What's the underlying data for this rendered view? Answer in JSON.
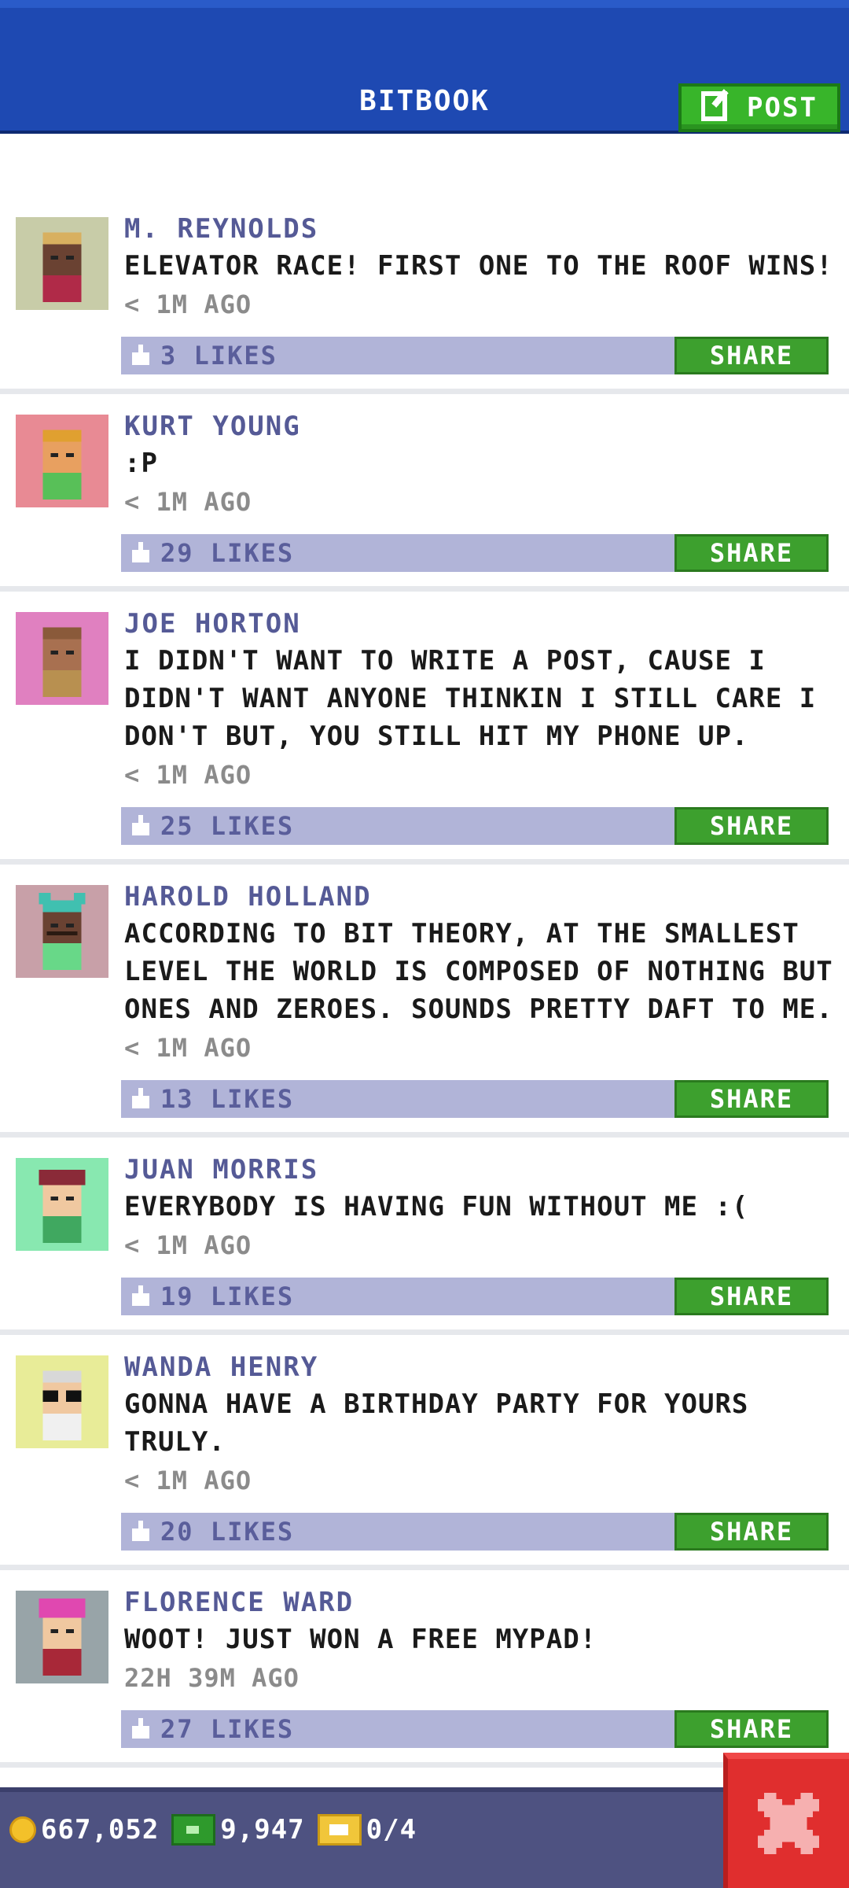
{
  "header": {
    "title": "BITBOOK",
    "post_button_label": "POST"
  },
  "colors": {
    "header_bg": "#1e49b2",
    "post_button_bg": "#38b52a",
    "likes_bar_bg": "#b1b4d8",
    "share_button_bg": "#3da02e",
    "author_color": "#555a96",
    "footer_bg": "#4e5281",
    "close_button_bg": "#e02e2e"
  },
  "posts": [
    {
      "author": "M. REYNOLDS",
      "message": "ELEVATOR RACE! FIRST ONE TO THE ROOF WINS!",
      "time": "< 1M AGO",
      "likes": "3 LIKES",
      "share_label": "SHARE"
    },
    {
      "author": "KURT YOUNG",
      "message": ":P",
      "time": "< 1M AGO",
      "likes": "29 LIKES",
      "share_label": "SHARE"
    },
    {
      "author": "JOE HORTON",
      "message": "I DIDN'T WANT TO WRITE A POST, CAUSE I DIDN'T WANT ANYONE THINKIN I STILL CARE I DON'T BUT, YOU STILL HIT MY PHONE UP.",
      "time": "< 1M AGO",
      "likes": "25 LIKES",
      "share_label": "SHARE"
    },
    {
      "author": "HAROLD HOLLAND",
      "message": "ACCORDING TO BIT THEORY, AT THE SMALLEST LEVEL THE WORLD IS COMPOSED OF NOTHING BUT ONES AND ZEROES. SOUNDS PRETTY DAFT TO ME.",
      "time": "< 1M AGO",
      "likes": "13 LIKES",
      "share_label": "SHARE"
    },
    {
      "author": "JUAN MORRIS",
      "message": "EVERYBODY IS HAVING FUN WITHOUT ME :(",
      "time": "< 1M AGO",
      "likes": "19 LIKES",
      "share_label": "SHARE"
    },
    {
      "author": "WANDA HENRY",
      "message": "GONNA HAVE A BIRTHDAY PARTY FOR YOURS TRULY.",
      "time": "< 1M AGO",
      "likes": "20 LIKES",
      "share_label": "SHARE"
    },
    {
      "author": "FLORENCE WARD",
      "message": "WOOT! JUST WON A FREE MYPAD!",
      "time": "22H 39M AGO",
      "likes": "27 LIKES",
      "share_label": "SHARE"
    }
  ],
  "footer": {
    "coins": "667,052",
    "bux": "9,947",
    "tickets": "0/4"
  }
}
